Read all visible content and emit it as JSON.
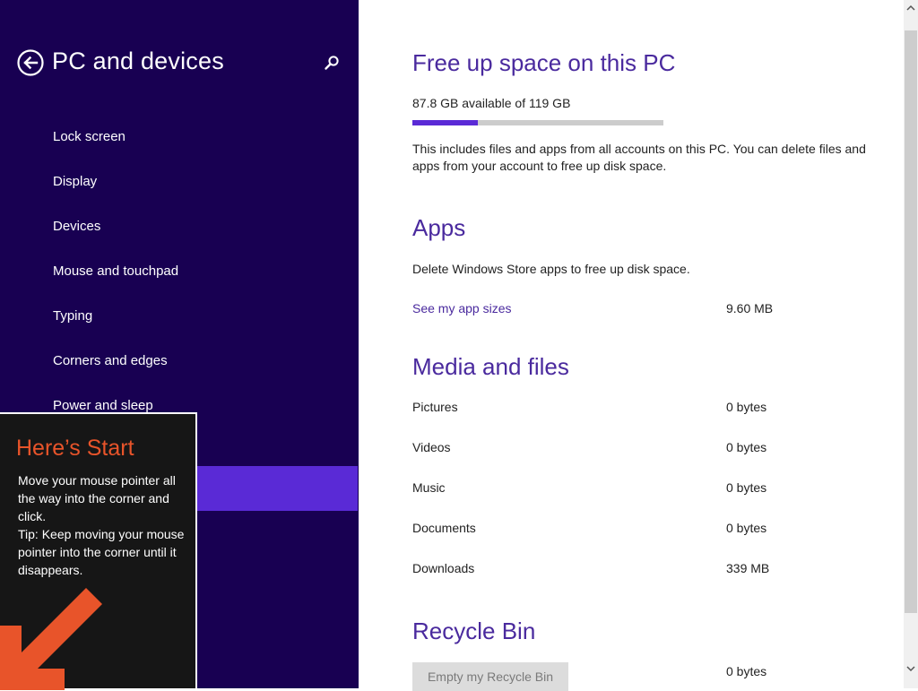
{
  "sidebar": {
    "title": "PC and devices",
    "items": [
      {
        "label": "Lock screen"
      },
      {
        "label": "Display"
      },
      {
        "label": "Devices"
      },
      {
        "label": "Mouse and touchpad"
      },
      {
        "label": "Typing"
      },
      {
        "label": "Corners and edges"
      },
      {
        "label": "Power and sleep"
      }
    ],
    "bg_color": "#180052",
    "selected_color": "#5a2ad6"
  },
  "tip": {
    "title": "Here’s Start",
    "line1": "Move your mouse pointer all the way into the corner and click.",
    "line2": "Tip: Keep moving your mouse pointer into the corner until it disappears.",
    "title_color": "#e8542a"
  },
  "main": {
    "free_space": {
      "heading": "Free up space on this PC",
      "available": "87.8 GB available of 119 GB",
      "used_fraction": 0.262,
      "description": "This includes files and apps from all accounts on this PC. You can delete files and apps from your account to free up disk space."
    },
    "apps": {
      "heading": "Apps",
      "description": "Delete Windows Store apps to free up disk space.",
      "link_label": "See my app sizes",
      "size": "9.60 MB"
    },
    "media": {
      "heading": "Media and files",
      "rows": [
        {
          "label": "Pictures",
          "size": "0 bytes"
        },
        {
          "label": "Videos",
          "size": "0 bytes"
        },
        {
          "label": "Music",
          "size": "0 bytes"
        },
        {
          "label": "Documents",
          "size": "0 bytes"
        },
        {
          "label": "Downloads",
          "size": "339 MB"
        }
      ]
    },
    "recycle": {
      "heading": "Recycle Bin",
      "button_label": "Empty my Recycle Bin",
      "size": "0 bytes"
    },
    "accent_color": "#4a2a9e"
  }
}
